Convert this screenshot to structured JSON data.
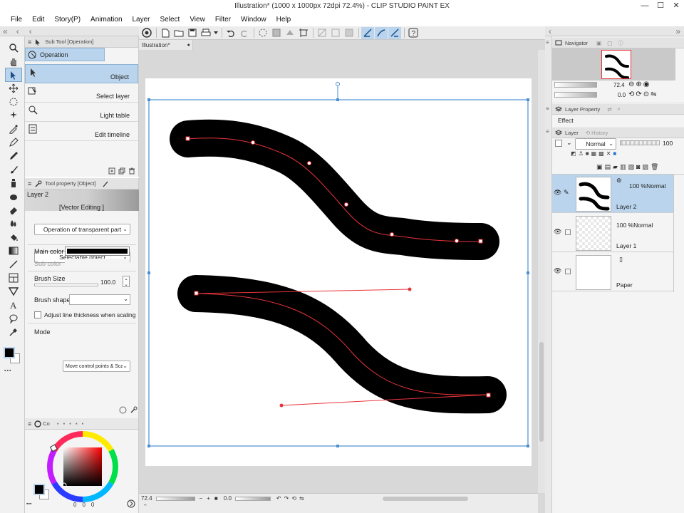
{
  "window": {
    "title": "Illustration* (1000 x 1000px 72dpi 72.4%) - CLIP STUDIO PAINT EX",
    "minimize": "—",
    "maximize": "☐",
    "close": "✕"
  },
  "menu": [
    "File",
    "Edit",
    "Story(P)",
    "Animation",
    "Layer",
    "Select",
    "View",
    "Filter",
    "Window",
    "Help"
  ],
  "subtool": {
    "header": "Sub Tool [Operation]",
    "group_tab": "Operation",
    "items": [
      "Object",
      "Select layer",
      "Light table",
      "Edit timeline"
    ]
  },
  "toolprop": {
    "header": "Tool property [Object]",
    "layer_name": "Layer 2",
    "vector_editing": "[Vector Editing ]",
    "operation_select": "Operation of transparent part",
    "selectable_select": "Selectable object",
    "main_color_label": "Main color",
    "sub_color_label": "Sub color",
    "brush_size_label": "Brush Size",
    "brush_size_value": "100.0",
    "brush_shape_label": "Brush shape",
    "adjust_label": "Adjust line thickness when scaling",
    "mode_label": "Mode",
    "mode_value": "Move control points & Scale"
  },
  "color_panel": {
    "tab_label": "Co",
    "values": [
      "0",
      "0",
      "0"
    ],
    "main_color": "#000000",
    "sub_color": "#ffffff",
    "picker_hue": "#ff0000"
  },
  "document_tab": "Illustration*",
  "canvas_status": {
    "zoom": "72.4",
    "rotation": "0.0"
  },
  "navigator": {
    "header": "Navigator",
    "zoom": "72.4",
    "rotation": "0.0"
  },
  "layer_property": {
    "header": "Layer Property",
    "effect_label": "Effect"
  },
  "layer_panel": {
    "tab_layer": "Layer",
    "tab_history": "History",
    "blend_mode": "Normal",
    "opacity": "100",
    "layers": [
      {
        "mode": "100 %Normal",
        "name": "Layer 2",
        "selected": true
      },
      {
        "mode": "100 %Normal",
        "name": "Layer 1",
        "selected": false
      },
      {
        "mode": "",
        "name": "Paper",
        "selected": false
      }
    ]
  },
  "colors": {
    "accent": "#b9d4ec",
    "selection_box": "#4a90d0",
    "vector_path": "#e8343a"
  }
}
